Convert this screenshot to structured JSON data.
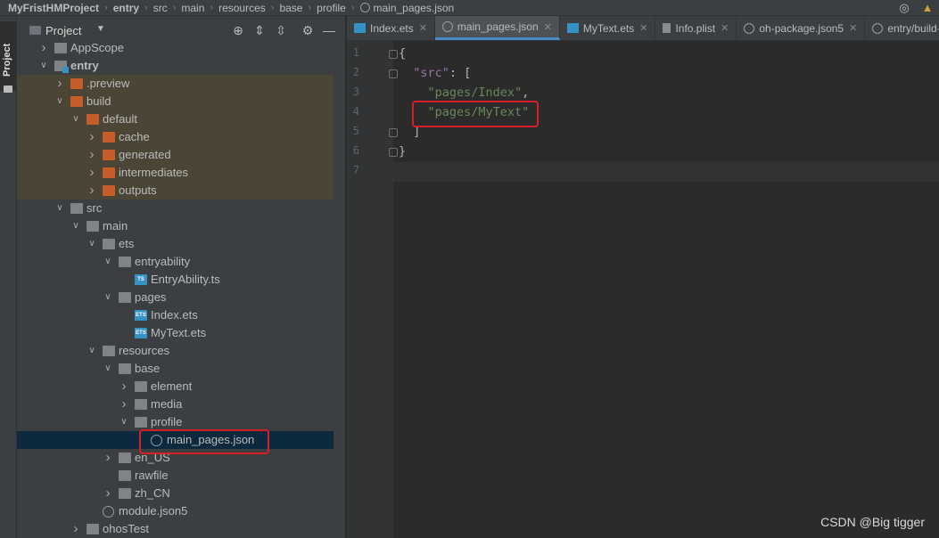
{
  "breadcrumbs": [
    "MyFristHMProject",
    "entry",
    "src",
    "main",
    "resources",
    "base",
    "profile",
    "main_pages.json"
  ],
  "side_strip": {
    "label": "Project"
  },
  "project_panel": {
    "title": "Project"
  },
  "tree": [
    {
      "label": "AppScope",
      "depth": 1,
      "chev": "right",
      "icon": "folder"
    },
    {
      "label": "entry",
      "depth": 1,
      "chev": "down",
      "icon": "module",
      "bold": true
    },
    {
      "label": ".preview",
      "depth": 2,
      "chev": "right",
      "icon": "folder-orange",
      "hl": true
    },
    {
      "label": "build",
      "depth": 2,
      "chev": "down",
      "icon": "folder-orange",
      "hl": true
    },
    {
      "label": "default",
      "depth": 3,
      "chev": "down",
      "icon": "folder-orange",
      "hl": true
    },
    {
      "label": "cache",
      "depth": 4,
      "chev": "right",
      "icon": "folder-orange",
      "hl": true
    },
    {
      "label": "generated",
      "depth": 4,
      "chev": "right",
      "icon": "folder-orange",
      "hl": true
    },
    {
      "label": "intermediates",
      "depth": 4,
      "chev": "right",
      "icon": "folder-orange",
      "hl": true
    },
    {
      "label": "outputs",
      "depth": 4,
      "chev": "right",
      "icon": "folder-orange",
      "hl": true
    },
    {
      "label": "src",
      "depth": 2,
      "chev": "down",
      "icon": "folder"
    },
    {
      "label": "main",
      "depth": 3,
      "chev": "down",
      "icon": "folder"
    },
    {
      "label": "ets",
      "depth": 4,
      "chev": "down",
      "icon": "folder"
    },
    {
      "label": "entryability",
      "depth": 5,
      "chev": "down",
      "icon": "folder"
    },
    {
      "label": "EntryAbility.ts",
      "depth": 6,
      "chev": "",
      "icon": "ts"
    },
    {
      "label": "pages",
      "depth": 5,
      "chev": "down",
      "icon": "folder"
    },
    {
      "label": "Index.ets",
      "depth": 6,
      "chev": "",
      "icon": "ets"
    },
    {
      "label": "MyText.ets",
      "depth": 6,
      "chev": "",
      "icon": "ets"
    },
    {
      "label": "resources",
      "depth": 4,
      "chev": "down",
      "icon": "folder"
    },
    {
      "label": "base",
      "depth": 5,
      "chev": "down",
      "icon": "folder"
    },
    {
      "label": "element",
      "depth": 6,
      "chev": "right",
      "icon": "folder"
    },
    {
      "label": "media",
      "depth": 6,
      "chev": "right",
      "icon": "folder"
    },
    {
      "label": "profile",
      "depth": 6,
      "chev": "down",
      "icon": "folder"
    },
    {
      "label": "main_pages.json",
      "depth": 7,
      "chev": "",
      "icon": "json",
      "sel": true
    },
    {
      "label": "en_US",
      "depth": 5,
      "chev": "right",
      "icon": "folder"
    },
    {
      "label": "rawfile",
      "depth": 5,
      "chev": "",
      "icon": "folder"
    },
    {
      "label": "zh_CN",
      "depth": 5,
      "chev": "right",
      "icon": "folder"
    },
    {
      "label": "module.json5",
      "depth": 4,
      "chev": "",
      "icon": "json"
    },
    {
      "label": "ohosTest",
      "depth": 3,
      "chev": "right",
      "icon": "folder"
    }
  ],
  "tabs": [
    {
      "label": "Index.ets",
      "icon": "ets",
      "active": false
    },
    {
      "label": "main_pages.json",
      "icon": "json",
      "active": true
    },
    {
      "label": "MyText.ets",
      "icon": "ets",
      "active": false
    },
    {
      "label": "Info.plist",
      "icon": "plist",
      "active": false
    },
    {
      "label": "oh-package.json5",
      "icon": "json",
      "active": false
    },
    {
      "label": "entry/build-pro",
      "icon": "json",
      "active": false
    }
  ],
  "code": {
    "line_numbers": [
      "1",
      "2",
      "3",
      "4",
      "5",
      "6",
      "7"
    ],
    "line1": "{",
    "key_src": "\"src\"",
    "colon_bracket": ": [",
    "str_index": "\"pages/Index\"",
    "comma": ",",
    "str_mytext": "\"pages/MyText\"",
    "close_bracket": "]",
    "close_brace": "}"
  },
  "watermark": "CSDN @Big tigger"
}
